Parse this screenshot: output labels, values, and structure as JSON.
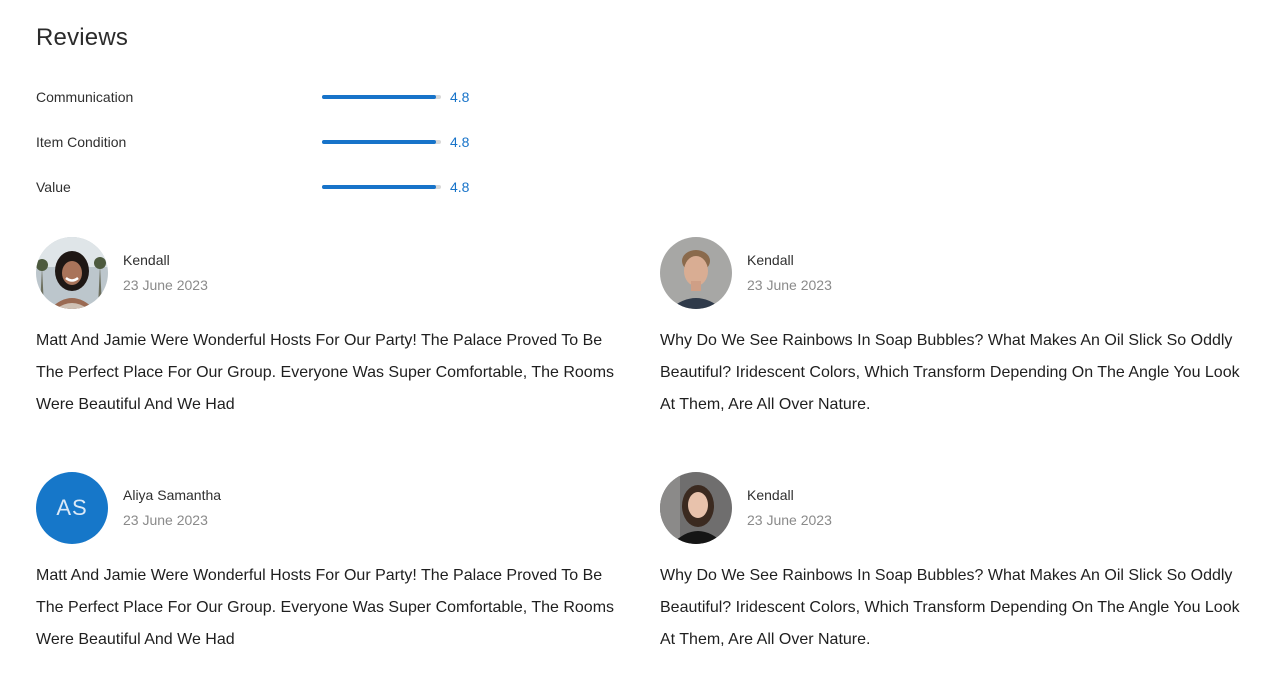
{
  "page": {
    "title": "Reviews"
  },
  "ratings": [
    {
      "label": "Communication",
      "value": "4.8",
      "fill_fraction": 0.96
    },
    {
      "label": "Item Condition",
      "value": "4.8",
      "fill_fraction": 0.96
    },
    {
      "label": "Value",
      "value": "4.8",
      "fill_fraction": 0.96
    }
  ],
  "reviews": [
    {
      "name": "Kendall",
      "date": "23 June 2023",
      "avatar": "photo-woman-smiling",
      "text": "Matt And Jamie Were Wonderful Hosts For Our Party! The Palace Proved To Be The Perfect Place For Our Group. Everyone Was Super Comfortable, The Rooms Were Beautiful And We Had"
    },
    {
      "name": "Kendall",
      "date": "23 June 2023",
      "avatar": "photo-man",
      "text": "Why Do We See Rainbows In Soap Bubbles? What Makes An Oil Slick So Oddly Beautiful? Iridescent Colors, Which Transform Depending On The Angle You Look At Them, Are All Over Nature."
    },
    {
      "name": "Aliya Samantha",
      "date": "23 June 2023",
      "avatar": "initials",
      "initials": "AS",
      "text": "Matt And Jamie Were Wonderful Hosts For Our Party! The Palace Proved To Be The Perfect Place For Our Group. Everyone Was Super Comfortable, The Rooms Were Beautiful And We Had"
    },
    {
      "name": "Kendall",
      "date": "23 June 2023",
      "avatar": "photo-woman-dark",
      "text": "Why Do We See Rainbows In Soap Bubbles? What Makes An Oil Slick So Oddly Beautiful? Iridescent Colors, Which Transform Depending On The Angle You Look At Them, Are All Over Nature."
    }
  ],
  "colors": {
    "accent": "#1773c9",
    "avatar_bg": "#1677c9",
    "bar_track": "#d8d8d8"
  }
}
